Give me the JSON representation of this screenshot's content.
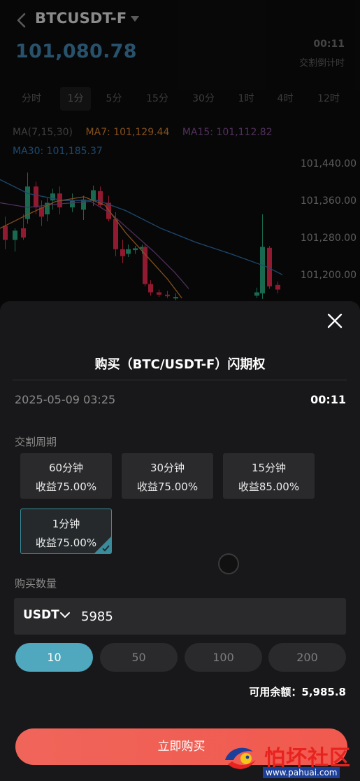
{
  "header": {
    "symbol": "BTCUSDT-F",
    "price": "101,080.78",
    "countdown": "00:11",
    "countdown_caption": "交割倒计时"
  },
  "intervals": [
    {
      "label": "分时",
      "active": false
    },
    {
      "label": "1分",
      "active": true
    },
    {
      "label": "5分",
      "active": false
    },
    {
      "label": "15分",
      "active": false
    },
    {
      "label": "30分",
      "active": false
    },
    {
      "label": "1时",
      "active": false
    },
    {
      "label": "4时",
      "active": false
    },
    {
      "label": "12时",
      "active": false
    }
  ],
  "indicators": {
    "ma_params": "MA(7,15,30)",
    "ma7": "MA7: 101,129.44",
    "ma15": "MA15: 101,112.82",
    "ma30": "MA30: 101,185.37"
  },
  "colors": {
    "up": "#26a17b",
    "down": "#e0294a",
    "ma7": "#c97a2b",
    "ma15": "#7b4b8a",
    "ma30": "#2b6fa8",
    "accent": "#4fa8bd",
    "buy": "#f1594e"
  },
  "chart_data": {
    "type": "candlestick",
    "y_ticks": [
      "101,440.00",
      "101,360.00",
      "101,280.00",
      "101,200.00"
    ],
    "ylim": [
      101140,
      101490
    ],
    "candles": [
      {
        "o": 101305,
        "h": 101325,
        "l": 101255,
        "c": 101275
      },
      {
        "o": 101275,
        "h": 101300,
        "l": 101250,
        "c": 101295
      },
      {
        "o": 101300,
        "h": 101330,
        "l": 101275,
        "c": 101280
      },
      {
        "o": 101320,
        "h": 101420,
        "l": 101310,
        "c": 101390
      },
      {
        "o": 101390,
        "h": 101400,
        "l": 101330,
        "c": 101345
      },
      {
        "o": 101345,
        "h": 101360,
        "l": 101305,
        "c": 101325
      },
      {
        "o": 101330,
        "h": 101365,
        "l": 101315,
        "c": 101355
      },
      {
        "o": 101360,
        "h": 101385,
        "l": 101340,
        "c": 101375
      },
      {
        "o": 101375,
        "h": 101390,
        "l": 101330,
        "c": 101345
      },
      {
        "o": 101345,
        "h": 101375,
        "l": 101335,
        "c": 101360
      },
      {
        "o": 101340,
        "h": 101370,
        "l": 101318,
        "c": 101362
      },
      {
        "o": 101360,
        "h": 101392,
        "l": 101348,
        "c": 101382
      },
      {
        "o": 101380,
        "h": 101390,
        "l": 101345,
        "c": 101350
      },
      {
        "o": 101355,
        "h": 101370,
        "l": 101315,
        "c": 101320
      },
      {
        "o": 101320,
        "h": 101335,
        "l": 101240,
        "c": 101255
      },
      {
        "o": 101255,
        "h": 101275,
        "l": 101225,
        "c": 101240
      },
      {
        "o": 101245,
        "h": 101265,
        "l": 101238,
        "c": 101255
      },
      {
        "o": 101253,
        "h": 101262,
        "l": 101245,
        "c": 101257
      },
      {
        "o": 101255,
        "h": 101265,
        "l": 101245,
        "c": 101260
      },
      {
        "o": 101260,
        "h": 101265,
        "l": 101175,
        "c": 101180
      },
      {
        "o": 101180,
        "h": 101188,
        "l": 101155,
        "c": 101162
      },
      {
        "o": 101162,
        "h": 101168,
        "l": 101152,
        "c": 101157
      },
      {
        "o": 101157,
        "h": 101165,
        "l": 101150,
        "c": 101154
      },
      {
        "o": 101150,
        "h": 101160,
        "l": 101145,
        "c": 101152
      },
      {
        "o": 101155,
        "h": 101172,
        "l": 101150,
        "c": 101162
      },
      {
        "o": 101160,
        "h": 101330,
        "l": 101148,
        "c": 101260
      },
      {
        "o": 101258,
        "h": 101262,
        "l": 101170,
        "c": 101175
      },
      {
        "o": 101178,
        "h": 101185,
        "l": 101160,
        "c": 101168
      }
    ],
    "candle_x": [
      4,
      18,
      30,
      36,
      48,
      56,
      64,
      72,
      82,
      100,
      116,
      130,
      140,
      152,
      162,
      172,
      180,
      190,
      200,
      204,
      212,
      224,
      236,
      248,
      364,
      372,
      382,
      394
    ],
    "ma7": [
      [
        0,
        101300
      ],
      [
        40,
        101330
      ],
      [
        80,
        101358
      ],
      [
        120,
        101368
      ],
      [
        150,
        101350
      ],
      [
        180,
        101290
      ],
      [
        210,
        101240
      ],
      [
        240,
        101190
      ],
      [
        260,
        101150
      ]
    ],
    "ma15": [
      [
        0,
        101355
      ],
      [
        40,
        101345
      ],
      [
        80,
        101352
      ],
      [
        130,
        101358
      ],
      [
        160,
        101330
      ],
      [
        190,
        101290
      ],
      [
        220,
        101250
      ],
      [
        250,
        101205
      ],
      [
        270,
        101170
      ]
    ],
    "ma30": [
      [
        0,
        101405
      ],
      [
        40,
        101375
      ],
      [
        90,
        101360
      ],
      [
        140,
        101360
      ],
      [
        180,
        101338
      ],
      [
        230,
        101300
      ],
      [
        280,
        101270
      ],
      [
        330,
        101245
      ],
      [
        380,
        101218
      ],
      [
        404,
        101200
      ]
    ]
  },
  "sheet": {
    "title": "购买（BTC/USDT-F）闪期权",
    "date": "2025-05-09 03:25",
    "countdown": "00:11",
    "period_label": "交割周期",
    "periods": [
      {
        "label": "60分钟",
        "rate": "收益75.00%",
        "selected": false
      },
      {
        "label": "30分钟",
        "rate": "收益75.00%",
        "selected": false
      },
      {
        "label": "15分钟",
        "rate": "收益85.00%",
        "selected": false
      },
      {
        "label": "1分钟",
        "rate": "收益75.00%",
        "selected": true
      }
    ],
    "amount_label": "购买数量",
    "currency": "USDT",
    "amount_value": "5985",
    "quick_amounts": [
      {
        "label": "10",
        "active": true
      },
      {
        "label": "50",
        "active": false
      },
      {
        "label": "100",
        "active": false
      },
      {
        "label": "200",
        "active": false
      }
    ],
    "balance": "可用余额：5,985.8",
    "buy_label": "立即购买"
  },
  "watermark": {
    "text": "怕坏社区",
    "url": "www.pahuai.com"
  }
}
